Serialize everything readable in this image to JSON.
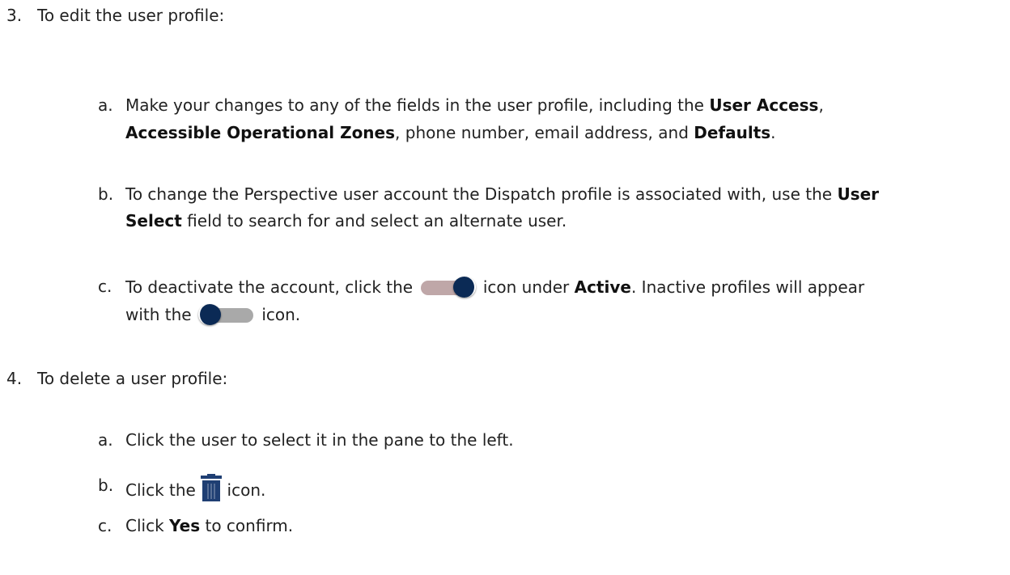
{
  "colors": {
    "text": "#222222",
    "toggle_on_track": "#bfa7a8",
    "toggle_off_track": "#a9a9a9",
    "toggle_knob": "#0b2a55",
    "trash": "#1f3f73"
  },
  "steps": [
    {
      "num": "3.",
      "title": "To edit the user profile:",
      "items": [
        {
          "letter": "a.",
          "l1_a": "Make your changes to any of the fields in the user profile, including the ",
          "l1_b": "User Access",
          "l1_c": ",",
          "l2_a": "Accessible Operational Zones",
          "l2_b": ", phone number, email address, and ",
          "l2_c": "Defaults",
          "l2_d": "."
        },
        {
          "letter": "b.",
          "l1_a": "To change the Perspective user account the Dispatch profile is associated with, use the ",
          "l1_b": "User",
          "l2_a": "Select",
          "l2_b": " field to search for and select an alternate user."
        },
        {
          "letter": "c.",
          "l1_a": "To deactivate the account, click the ",
          "l1_b": " icon under ",
          "l1_c": "Active",
          "l1_d": ". Inactive profiles will appear",
          "l2_a": "with the ",
          "l2_b": " icon.",
          "icon_on": "toggle-on-icon",
          "icon_off": "toggle-off-icon"
        }
      ]
    },
    {
      "num": "4.",
      "title": "To delete a user profile:",
      "items": [
        {
          "letter": "a.",
          "text": "Click the user to select it in the pane to the left."
        },
        {
          "letter": "b.",
          "a": "Click the ",
          "b": " icon.",
          "icon": "trash-icon"
        },
        {
          "letter": "c.",
          "a": "Click ",
          "b": "Yes",
          "c": " to confirm."
        }
      ]
    }
  ]
}
